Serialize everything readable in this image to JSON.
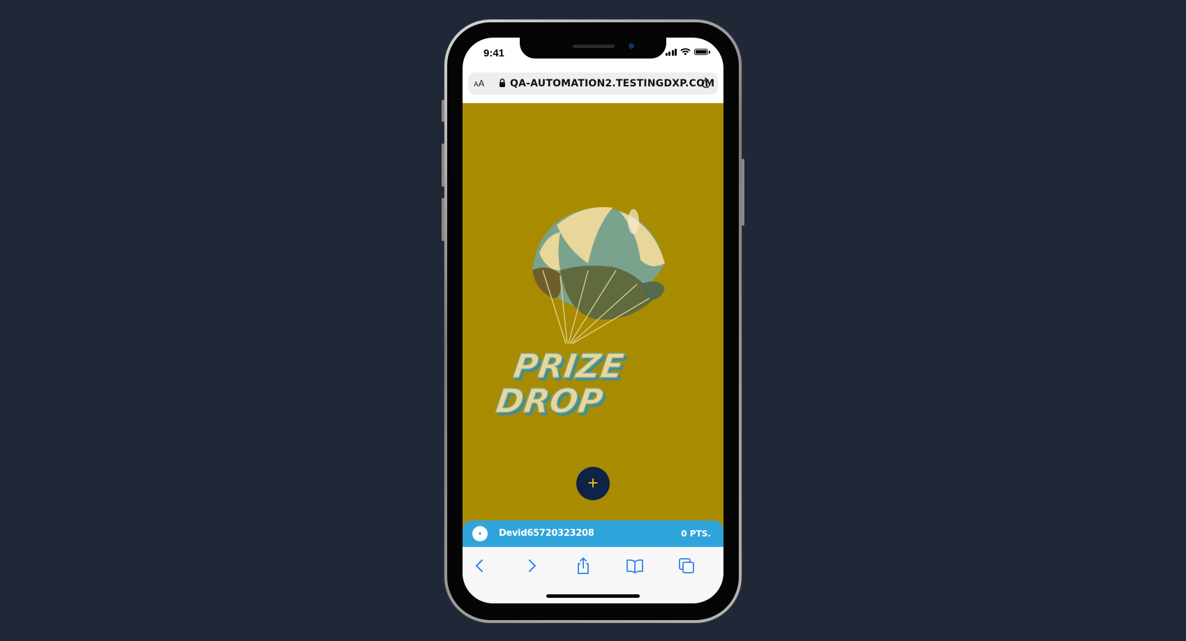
{
  "status_bar": {
    "time": "9:41"
  },
  "browser": {
    "text_size_label": "AA",
    "url": "QA-AUTOMATION2.TESTINGDXP.COM"
  },
  "page": {
    "background_color": "#a98b02",
    "logo_text_line1": "PRIZE",
    "logo_text_line2": "DROP",
    "fab_label": "+"
  },
  "user_bar": {
    "username": "Devid65720323208",
    "points": "0 PTS."
  },
  "toolbar": {
    "items": [
      "back-icon",
      "forward-icon",
      "share-icon",
      "bookmarks-icon",
      "tabs-icon"
    ]
  }
}
